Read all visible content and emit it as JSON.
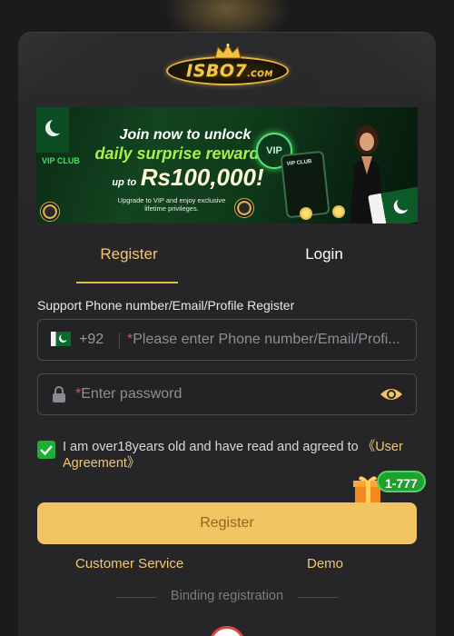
{
  "header": {
    "logo_text": "ISBO7",
    "logo_domain": ".COM"
  },
  "banner": {
    "line1": "Join now to unlock",
    "line2": "daily surprise rewards",
    "line3_prefix": "up to",
    "line3_amount": "Rs100,000!",
    "line4": "Upgrade to VIP and enjoy exclusive lifetime privileges.",
    "vip_club": "VIP CLUB",
    "vip_badge": "VIP",
    "phone_label": "VIP CLUB"
  },
  "tabs": [
    {
      "label": "Register",
      "active": true
    },
    {
      "label": "Login",
      "active": false
    }
  ],
  "form": {
    "support_label": "Support Phone number/Email/Profile Register",
    "country_code": "+92",
    "phone_placeholder": "Please enter Phone number/Email/Profi...",
    "password_placeholder": "Enter password",
    "required_mark": "*",
    "agree_text": "I am over18years old and have read and agreed to",
    "agree_link": "《User Agreement》",
    "agree_checked": true,
    "register_button": "Register"
  },
  "promo": {
    "badge": "1-777"
  },
  "footer": {
    "customer_service": "Customer Service",
    "demo": "Demo",
    "binding_label": "Binding registration"
  },
  "colors": {
    "accent": "#f2c770",
    "button": "#f2c462",
    "background": "#262628",
    "check_green": "#1fae35"
  }
}
